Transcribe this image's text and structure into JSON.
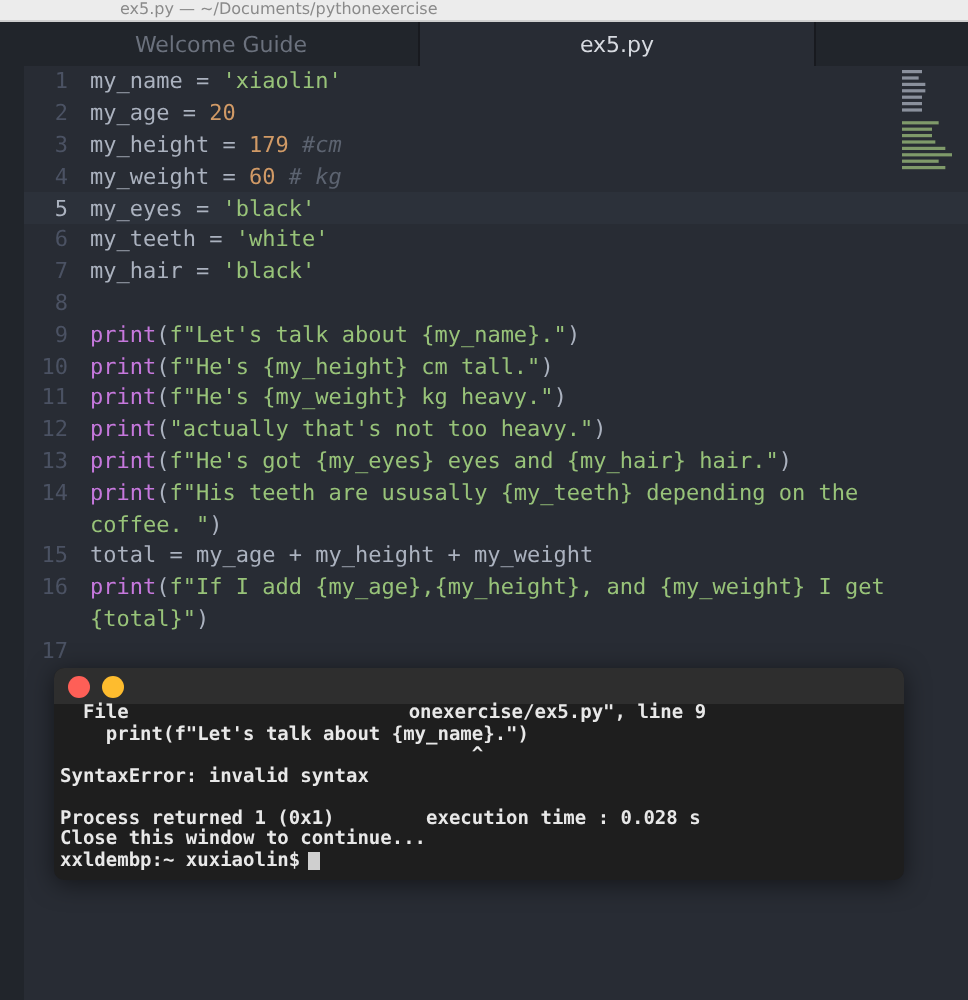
{
  "window": {
    "title": "ex5.py — ~/Documents/pythonexercise"
  },
  "tabs": [
    {
      "label": "Welcome Guide",
      "selected": false
    },
    {
      "label": "ex5.py",
      "selected": true
    }
  ],
  "editor": {
    "lines": [
      {
        "number": "1",
        "current": false,
        "tokens": [
          {
            "kind": "name",
            "text": "my_name = "
          },
          {
            "kind": "string",
            "text": "'xiaolin'"
          }
        ]
      },
      {
        "number": "2",
        "current": false,
        "tokens": [
          {
            "kind": "name",
            "text": "my_age = "
          },
          {
            "kind": "number",
            "text": "20"
          }
        ]
      },
      {
        "number": "3",
        "current": false,
        "tokens": [
          {
            "kind": "name",
            "text": "my_height = "
          },
          {
            "kind": "number",
            "text": "179"
          },
          {
            "kind": "comment",
            "text": " #cm"
          }
        ]
      },
      {
        "number": "4",
        "current": false,
        "tokens": [
          {
            "kind": "name",
            "text": "my_weight = "
          },
          {
            "kind": "number",
            "text": "60"
          },
          {
            "kind": "comment",
            "text": " # kg"
          }
        ]
      },
      {
        "number": "5",
        "current": true,
        "tokens": [
          {
            "kind": "name",
            "text": "my_eyes = "
          },
          {
            "kind": "string",
            "text": "'black'"
          }
        ]
      },
      {
        "number": "6",
        "current": false,
        "tokens": [
          {
            "kind": "name",
            "text": "my_teeth = "
          },
          {
            "kind": "string",
            "text": "'white'"
          }
        ]
      },
      {
        "number": "7",
        "current": false,
        "tokens": [
          {
            "kind": "name",
            "text": "my_hair = "
          },
          {
            "kind": "string",
            "text": "'black'"
          }
        ]
      },
      {
        "number": "8",
        "current": false
      },
      {
        "number": "9",
        "current": false,
        "tokens": [
          {
            "kind": "keyword",
            "text": "print"
          },
          {
            "kind": "name",
            "text": "("
          },
          {
            "kind": "string",
            "text": "f\"Let's talk about {my_name}.\""
          },
          {
            "kind": "name",
            "text": ")"
          }
        ]
      },
      {
        "number": "10",
        "current": false,
        "tokens": [
          {
            "kind": "keyword",
            "text": "print"
          },
          {
            "kind": "name",
            "text": "("
          },
          {
            "kind": "string",
            "text": "f\"He's {my_height} cm tall.\""
          },
          {
            "kind": "name",
            "text": ")"
          }
        ]
      },
      {
        "number": "11",
        "current": false,
        "tokens": [
          {
            "kind": "keyword",
            "text": "print"
          },
          {
            "kind": "name",
            "text": "("
          },
          {
            "kind": "string",
            "text": "f\"He's {my_weight} kg heavy.\""
          },
          {
            "kind": "name",
            "text": ")"
          }
        ]
      },
      {
        "number": "12",
        "current": false,
        "tokens": [
          {
            "kind": "keyword",
            "text": "print"
          },
          {
            "kind": "name",
            "text": "("
          },
          {
            "kind": "string",
            "text": "\"actually that's not too heavy.\""
          },
          {
            "kind": "name",
            "text": ")"
          }
        ]
      },
      {
        "number": "13",
        "current": false,
        "tokens": [
          {
            "kind": "keyword",
            "text": "print"
          },
          {
            "kind": "name",
            "text": "("
          },
          {
            "kind": "string",
            "text": "f\"He's got {my_eyes} eyes and {my_hair} hair.\""
          },
          {
            "kind": "name",
            "text": ")"
          }
        ]
      },
      {
        "number": "14",
        "current": false,
        "tokens": [
          {
            "kind": "keyword",
            "text": "print"
          },
          {
            "kind": "name",
            "text": "("
          },
          {
            "kind": "string",
            "text": "f\"His teeth are ususally {my_teeth} depending on the"
          }
        ],
        "wrap": [
          {
            "kind": "string",
            "text": "coffee. \""
          },
          {
            "kind": "name",
            "text": ")"
          }
        ]
      },
      {
        "number": "15",
        "current": false,
        "tokens": [
          {
            "kind": "name",
            "text": "total = my_age + my_height + my_weight"
          }
        ]
      },
      {
        "number": "16",
        "current": false,
        "tokens": [
          {
            "kind": "keyword",
            "text": "print"
          },
          {
            "kind": "name",
            "text": "("
          },
          {
            "kind": "string",
            "text": "f\"If I add {my_age},{my_height}, and {my_weight} I get"
          }
        ],
        "wrap": [
          {
            "kind": "string",
            "text": "{total}\""
          },
          {
            "kind": "name",
            "text": ")"
          }
        ]
      },
      {
        "number": "17",
        "current": false
      }
    ]
  },
  "terminal": {
    "lines": [
      {
        "kind": "split",
        "parts": [
          "File",
          "onexercise/ex5.py\", line 9"
        ]
      },
      {
        "kind": "text",
        "text": "    print(f\"Let's talk about {my_name}.\")"
      },
      {
        "kind": "text",
        "text": "                                    ^"
      },
      {
        "kind": "text",
        "text": "SyntaxError: invalid syntax"
      },
      {
        "kind": "blank"
      },
      {
        "kind": "text",
        "text": "Process returned 1 (0x1)        execution time : 0.028 s"
      },
      {
        "kind": "text",
        "text": "Close this window to continue..."
      },
      {
        "kind": "prompt",
        "text": "xxldembp:~ xuxiaolin$"
      }
    ]
  }
}
